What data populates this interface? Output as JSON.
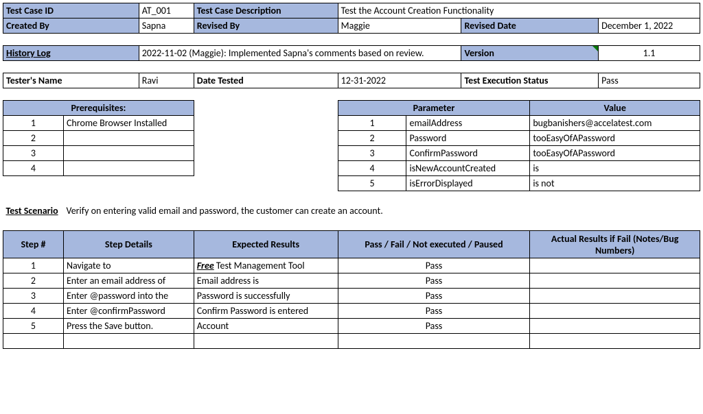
{
  "header": {
    "testCaseIdLabel": "Test Case ID",
    "testCaseId": "AT_001",
    "descLabel": "Test Case Description",
    "desc": "Test the Account Creation Functionality",
    "createdByLabel": "Created By",
    "createdBy": "Sapna",
    "revisedByLabel": "Revised By",
    "revisedBy": "Maggie",
    "revisedDateLabel": "Revised Date",
    "revisedDate": "December 1, 2022"
  },
  "history": {
    "label": "History Log",
    "text": "2022-11-02 (Maggie): Implemented Sapna's comments based on review.",
    "versionLabel": "Version",
    "version": "1.1"
  },
  "tester": {
    "nameLabel": "Tester's Name",
    "name": "Ravi",
    "dateTestedLabel": "Date Tested",
    "dateTested": "12-31-2022",
    "execStatusLabel": "Test Execution Status",
    "execStatus": "Pass"
  },
  "prereqLabel": "Prerequisites:",
  "paramLabel": "Parameter",
  "valueLabel": "Value",
  "prereq": {
    "n1": "1",
    "v1": "Chrome Browser Installed",
    "n2": "2",
    "v2": "",
    "n3": "3",
    "v3": "",
    "n4": "4",
    "v4": ""
  },
  "params": {
    "n1": "1",
    "p1": "emailAddress",
    "v1": "bugbanishers@accelatest.com",
    "n2": "2",
    "p2": "Password",
    "v2": "tooEasyOfAPassword",
    "n3": "3",
    "p3": "ConfirmPassword",
    "v3": "tooEasyOfAPassword",
    "n4": "4",
    "p4": "isNewAccountCreated",
    "v4": "is",
    "n5": "5",
    "p5": "isErrorDisplayed",
    "v5": "is not"
  },
  "scenario": {
    "label": "Test Scenario",
    "text": "Verify on entering valid email and password, the customer can create an account."
  },
  "stepsHeader": {
    "stepNum": "Step #",
    "details": "Step Details",
    "expected": "Expected Results",
    "pf": "Pass / Fail / Not executed / Paused",
    "actual": "Actual Results if Fail (Notes/Bug Numbers)"
  },
  "steps": {
    "s1n": "1",
    "s1d": "Navigate to",
    "s1eFree": "Free",
    "s1eRest": "  Test Management Tool",
    "s1p": "Pass",
    "s1a": "",
    "s2n": "2",
    "s2d": "Enter an email address of",
    "s2e": "Email address is",
    "s2p": "Pass",
    "s2a": "",
    "s3n": "3",
    "s3d": "Enter @password into the",
    "s3e": "Password is successfully",
    "s3p": "Pass",
    "s3a": "",
    "s4n": "4",
    "s4d": "Enter @confirmPassword",
    "s4e": "Confirm Password is entered",
    "s4p": "Pass",
    "s4a": "",
    "s5n": "5",
    "s5d": "Press the Save button.",
    "s5e": "Account",
    "s5p": "Pass",
    "s5a": ""
  }
}
